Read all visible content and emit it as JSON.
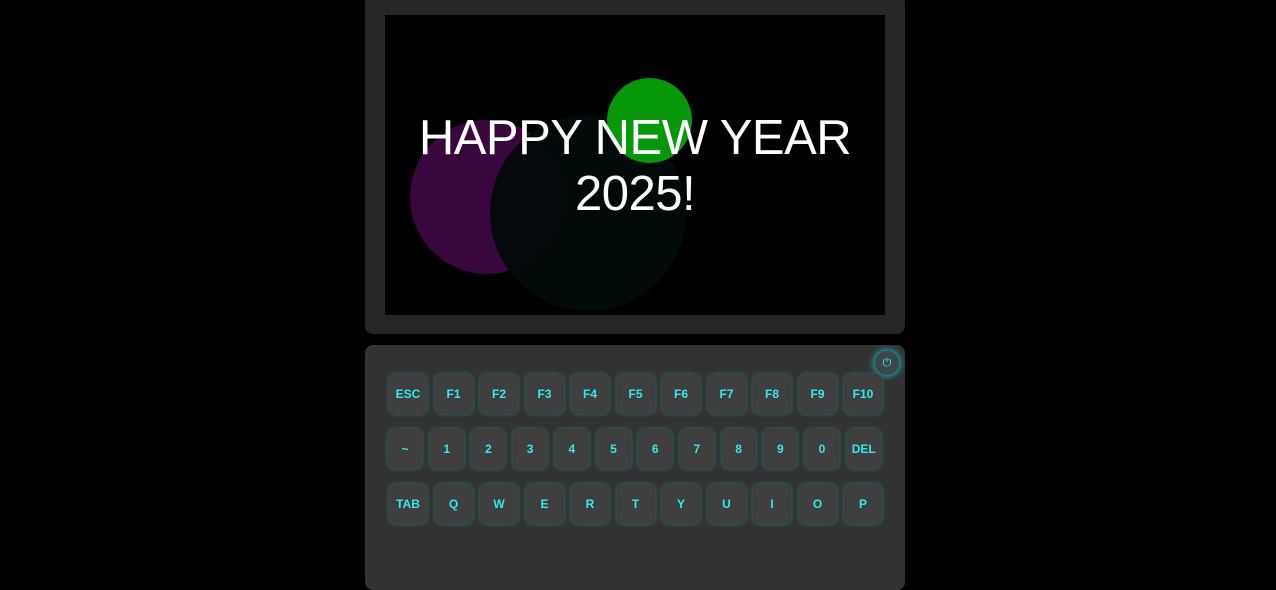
{
  "screen": {
    "greeting_line1": "HAPPY NEW YEAR",
    "greeting_line2": "2025!"
  },
  "keyboard": {
    "power_icon": "power-icon",
    "power_glyph": "⏻",
    "rows": [
      [
        "ESC",
        "F1",
        "F2",
        "F3",
        "F4",
        "F5",
        "F6",
        "F7",
        "F8",
        "F9",
        "F10"
      ],
      [
        "~",
        "1",
        "2",
        "3",
        "4",
        "5",
        "6",
        "7",
        "8",
        "9",
        "0",
        "DEL"
      ],
      [
        "TAB",
        "Q",
        "W",
        "E",
        "R",
        "T",
        "Y",
        "U",
        "I",
        "O",
        "P"
      ]
    ]
  },
  "colors": {
    "key_text": "#36e7ec",
    "bubble_green": "#06980a",
    "bubble_purple": "#3a063e"
  }
}
